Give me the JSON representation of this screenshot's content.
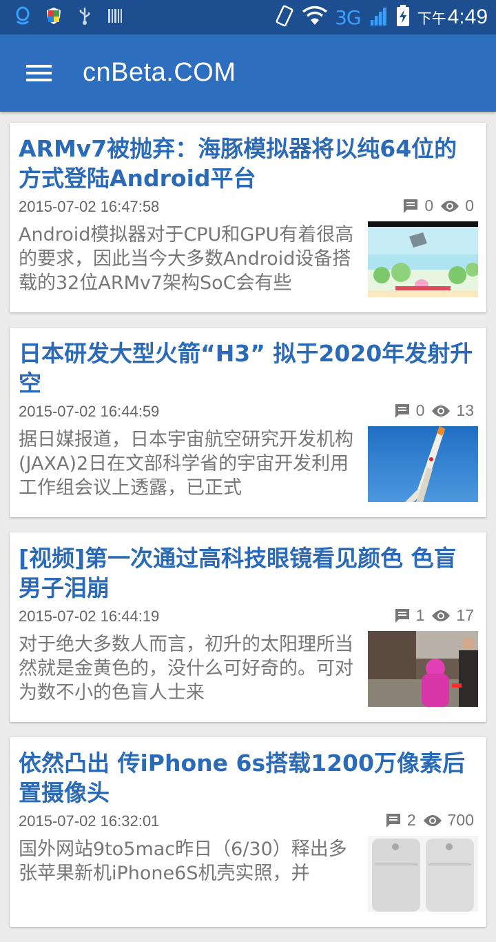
{
  "status_bar": {
    "network": "3G",
    "time_ampm": "下午",
    "time": "4:49"
  },
  "app_bar": {
    "title": "cnBeta.COM"
  },
  "articles": [
    {
      "title": "ARMv7被抛弃：海豚模拟器将以纯64位的方式登陆Android平台",
      "time": "2015-07-02 16:47:58",
      "comments": "0",
      "views": "0",
      "summary": "Android模拟器对于CPU和GPU有着很高的要求，因此当今大多数Android设备搭载的32位ARMv7架构SoC会有些",
      "thumb": "game-screenshot"
    },
    {
      "title": "日本研发大型火箭“H3” 拟于2020年发射升空",
      "time": "2015-07-02 16:44:59",
      "comments": "0",
      "views": "13",
      "summary": "据日媒报道，日本宇宙航空研究开发机构(JAXA)2日在文部科学省的宇宙开发利用工作组会议上透露，已正式",
      "thumb": "rocket-photo"
    },
    {
      "title": "[视频]第一次通过高科技眼镜看见颜色 色盲男子泪崩",
      "time": "2015-07-02 16:44:19",
      "comments": "1",
      "views": "17",
      "summary": "对于绝大多数人而言，初升的太阳理所当然就是金黄色的，没什么可好奇的。可对为数不小的色盲人士来",
      "thumb": "people-photo"
    },
    {
      "title": "依然凸出 传iPhone 6s搭载1200万像素后置摄像头",
      "time": "2015-07-02 16:32:01",
      "comments": "2",
      "views": "700",
      "summary": "国外网站9to5mac昨日（6/30）释出多张苹果新机iPhone6S机壳实照，并",
      "thumb": "iphone-case-photo"
    }
  ]
}
